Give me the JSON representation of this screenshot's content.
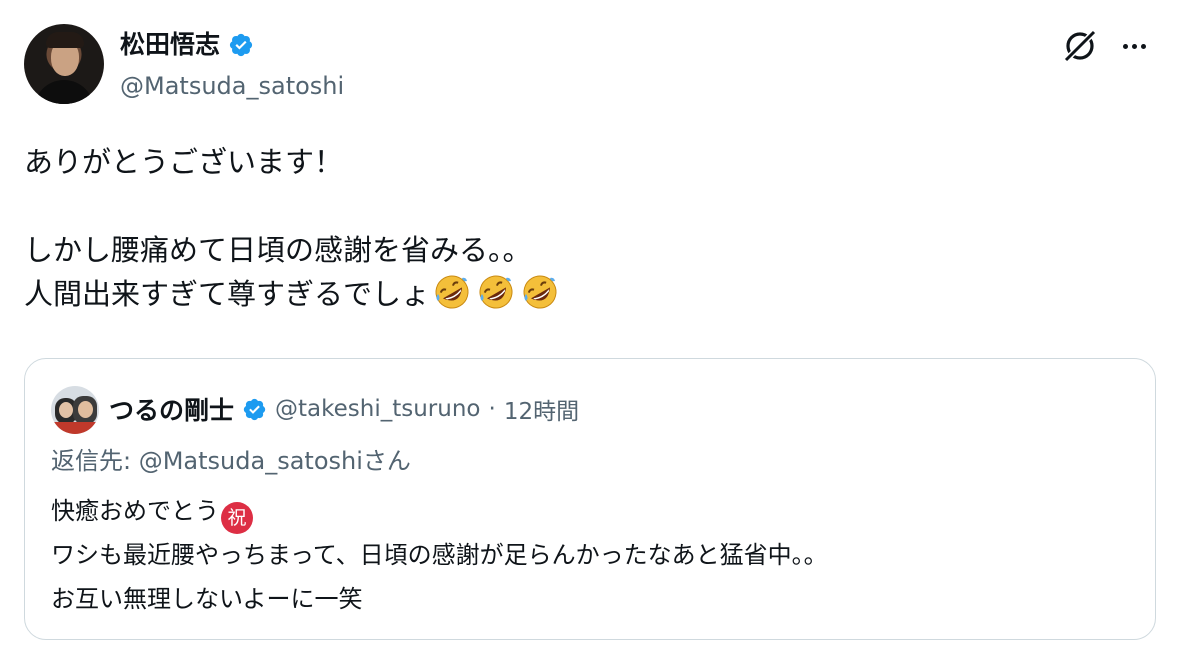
{
  "author": {
    "display_name": "松田悟志",
    "handle": "@Matsuda_satoshi",
    "verified": true
  },
  "actions": {
    "grok_icon": "grok-icon",
    "more_icon": "more-icon"
  },
  "tweet": {
    "lines": [
      "ありがとうございます！",
      "",
      "しかし腰痛めて日頃の感謝を省みる。。",
      "人間出来すぎて尊すぎるでしょ"
    ],
    "emoji_count": 3,
    "emoji": "rolling-on-the-floor-laughing"
  },
  "quote": {
    "display_name": "つるの剛士",
    "handle": "@takeshi_tsuruno",
    "separator": "·",
    "time": "12時間",
    "verified": true,
    "reply_to": "返信先: @Matsuda_satoshiさん",
    "lines": [
      "快癒おめでとう",
      "ワシも最近腰やっちまって、日頃の感謝が足らんかったなあと猛省中。。",
      "お互い無理しないよーに一笑"
    ],
    "celebrate_glyph": "祝"
  },
  "colors": {
    "text": "#0f1419",
    "secondary": "#536471",
    "verified_blue": "#1d9bf0",
    "border": "#cfd9de",
    "celebrate_red": "#dd2e44"
  }
}
